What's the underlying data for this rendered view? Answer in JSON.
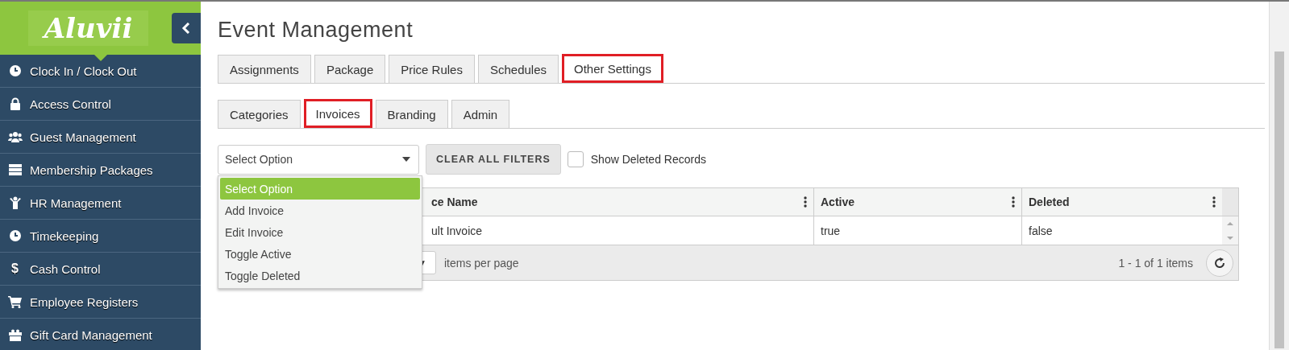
{
  "sidebar": {
    "logo": "Aluvii",
    "items": [
      {
        "label": "Clock In / Clock Out",
        "kind": "clock"
      },
      {
        "label": "Access Control",
        "kind": "lock"
      },
      {
        "label": "Guest Management",
        "kind": "users"
      },
      {
        "label": "Membership Packages",
        "kind": "card"
      },
      {
        "label": "HR Management",
        "kind": "person"
      },
      {
        "label": "Timekeeping",
        "kind": "clock"
      },
      {
        "label": "Cash Control",
        "kind": "glyph",
        "glyph": "$"
      },
      {
        "label": "Employee Registers",
        "kind": "cart"
      },
      {
        "label": "Gift Card Management",
        "kind": "gift"
      }
    ]
  },
  "title": "Event Management",
  "tabs": [
    {
      "label": "Assignments",
      "selected": false,
      "highlighted": false
    },
    {
      "label": "Package",
      "selected": false,
      "highlighted": false
    },
    {
      "label": "Price Rules",
      "selected": false,
      "highlighted": false
    },
    {
      "label": "Schedules",
      "selected": false,
      "highlighted": false
    },
    {
      "label": "Other Settings",
      "selected": true,
      "highlighted": true
    }
  ],
  "subtabs": [
    {
      "label": "Categories",
      "selected": false,
      "highlighted": false
    },
    {
      "label": "Invoices",
      "selected": true,
      "highlighted": true
    },
    {
      "label": "Branding",
      "selected": false,
      "highlighted": false
    },
    {
      "label": "Admin",
      "selected": false,
      "highlighted": false
    }
  ],
  "filters": {
    "select_value": "Select Option",
    "clear_button": "CLEAR ALL FILTERS",
    "show_deleted": {
      "label": "Show Deleted Records",
      "checked": false
    }
  },
  "dropdown_options": [
    {
      "label": "Select Option",
      "selected": true
    },
    {
      "label": "Add Invoice",
      "selected": false
    },
    {
      "label": "Edit Invoice",
      "selected": false
    },
    {
      "label": "Toggle Active",
      "selected": false
    },
    {
      "label": "Toggle Deleted",
      "selected": false
    }
  ],
  "table": {
    "columns": [
      "ce Name",
      "Active",
      "Deleted"
    ],
    "rows": [
      [
        "ult Invoice",
        "true",
        "false"
      ]
    ],
    "pager": {
      "caret": "▼",
      "label": "items per page",
      "summary": "1 - 1 of 1 items"
    }
  }
}
